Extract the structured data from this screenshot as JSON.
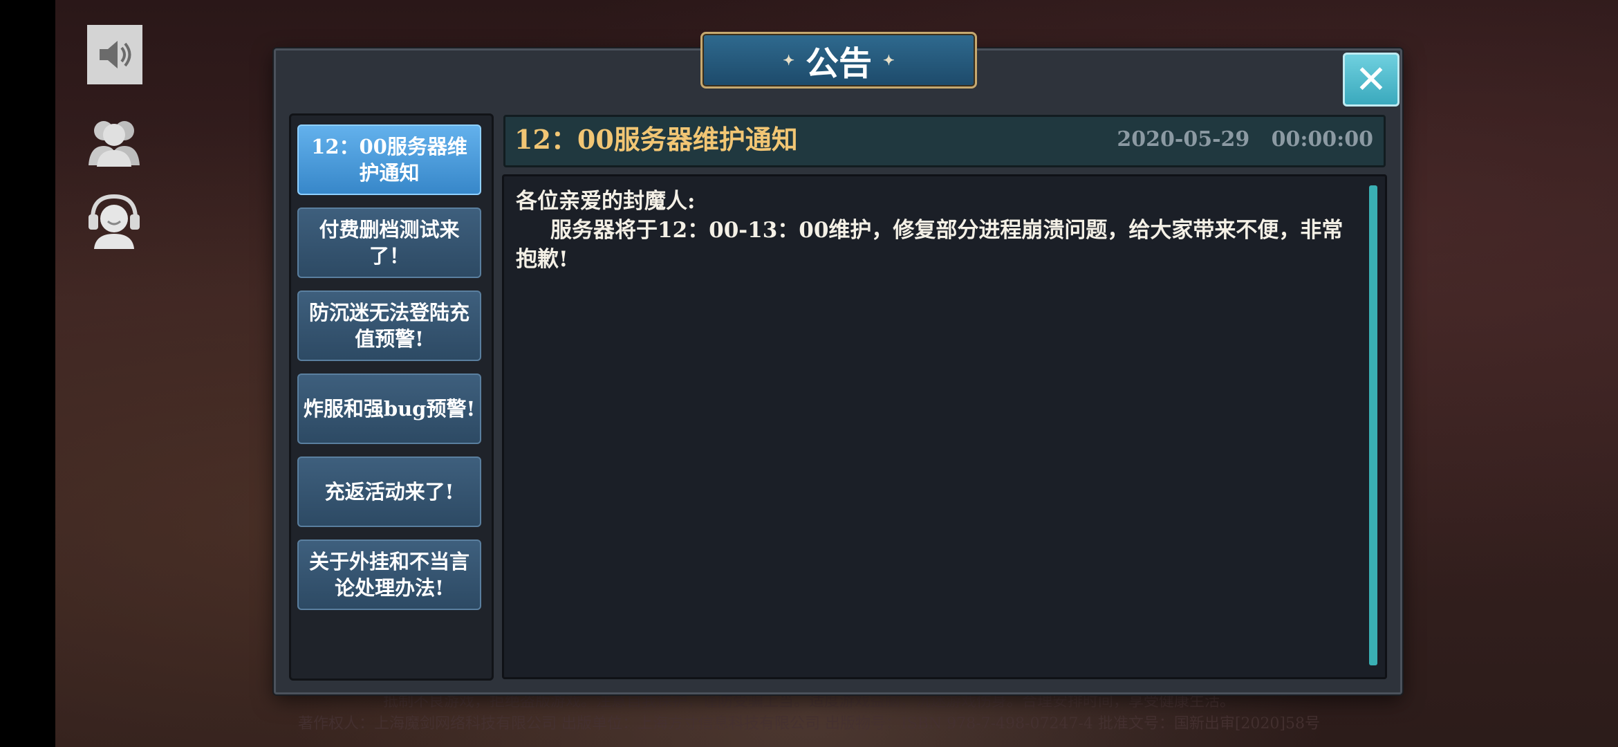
{
  "dialog": {
    "title": "公告"
  },
  "announcements": [
    {
      "label": "12：00服务器维护通知",
      "active": true
    },
    {
      "label": "付费删档测试来了！"
    },
    {
      "label": "防沉迷无法登陆充值预警!"
    },
    {
      "label": "炸服和强bug预警!"
    },
    {
      "label": "充返活动来了!"
    },
    {
      "label": "关于外挂和不当言论处理办法!"
    }
  ],
  "detail": {
    "title": "12：00服务器维护通知",
    "date": "2020-05-29   00:00:00",
    "greeting": "各位亲爱的封魔人:",
    "body": "服务器将于12：00-13：00维护，修复部分进程崩溃问题，给大家带来不便，非常抱歉!"
  },
  "footer": {
    "line1": "抵制不良游戏，拒绝盗版游戏。注意自我保护，谨防受骗上当。适度游戏益脑，沉迷游戏伤身。合理安排时间，享受健康生活。",
    "line2": "著作权人：上海魔剑网络科技有限公司  出版单位：上海方寸信息科技有限公司  出版物号：ISBN 978-7-498-07247-4  批准文号：国新出审[2020]58号"
  },
  "icons": {
    "sound": "speaker-icon",
    "friends": "friends-icon",
    "service": "customer-service-icon",
    "close": "close-icon"
  },
  "colors": {
    "accent_title": "#f2c674",
    "active_tab": "#4a9ee0",
    "close_button": "#55c3d3"
  }
}
